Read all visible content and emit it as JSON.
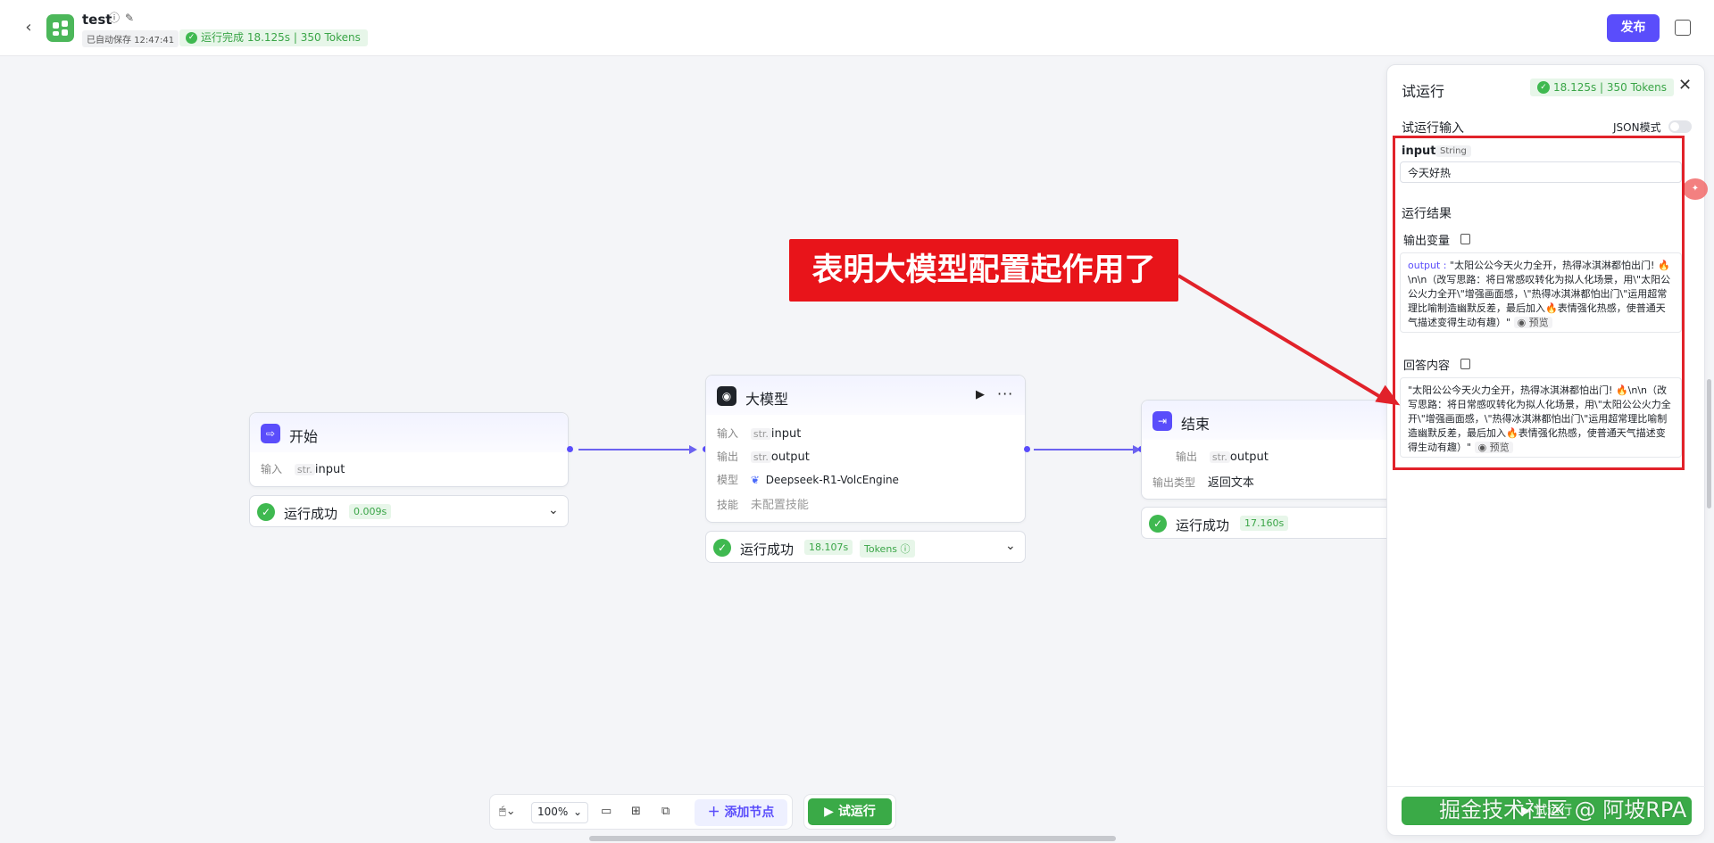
{
  "header": {
    "title": "test",
    "autosave": "已自动保存 12:47:41",
    "run_status": "运行完成 18.125s | 350 Tokens",
    "publish_label": "发布"
  },
  "nodes": {
    "start": {
      "title": "开始",
      "input_label": "输入",
      "input_type": "str.",
      "input_value": "input",
      "status": "运行成功",
      "time": "0.009s"
    },
    "llm": {
      "title": "大模型",
      "input_label": "输入",
      "input_type": "str.",
      "input_value": "input",
      "output_label": "输出",
      "output_type": "str.",
      "output_value": "output",
      "model_label": "模型",
      "model_value": "Deepseek-R1-VolcEngine",
      "skill_label": "技能",
      "skill_value": "未配置技能",
      "status": "运行成功",
      "time": "18.107s",
      "tokens": "Tokens"
    },
    "end": {
      "title": "结束",
      "output_label": "输出",
      "output_type": "str.",
      "output_value": "output",
      "output_type_label": "输出类型",
      "output_type_value": "返回文本",
      "status": "运行成功",
      "time": "17.160s"
    }
  },
  "panel": {
    "title": "试运行",
    "badge": "18.125s | 350 Tokens",
    "input_section": "试运行输入",
    "json_mode": "JSON模式",
    "input_name": "input",
    "input_type": "String",
    "input_value": "今天好热",
    "result_section": "运行结果",
    "output_var_label": "输出变量",
    "output_key": "output :",
    "output_text": "\"太阳公公今天火力全开，热得冰淇淋都怕出门! 🔥\\n\\n（改写思路：将日常感叹转化为拟人化场景，用\\\"太阳公公火力全开\\\"增强画面感，\\\"热得冰淇淋都怕出门\\\"运用超常理比喻制造幽默反差，最后加入🔥表情强化热感，使普通天气描述变得生动有趣）\"",
    "preview": "预览",
    "answer_label": "回答内容",
    "answer_text": "\"太阳公公今天火力全开，热得冰淇淋都怕出门! 🔥\\n\\n（改写思路：将日常感叹转化为拟人化场景，用\\\"太阳公公火力全开\\\"增强画面感，\\\"热得冰淇淋都怕出门\\\"运用超常理比喻制造幽默反差，最后加入🔥表情强化热感，使普通天气描述变得生动有趣）\"",
    "footer_button": "试运行"
  },
  "annotation": {
    "callout": "表明大模型配置起作用了"
  },
  "toolbar": {
    "zoom": "100%",
    "add_node": "添加节点",
    "run": "试运行"
  },
  "watermark": "掘金技术社区 @ 阿坡RPA",
  "colors": {
    "brand": "#5a4dfb",
    "success": "#3fb950",
    "annotation": "#e1222a"
  }
}
